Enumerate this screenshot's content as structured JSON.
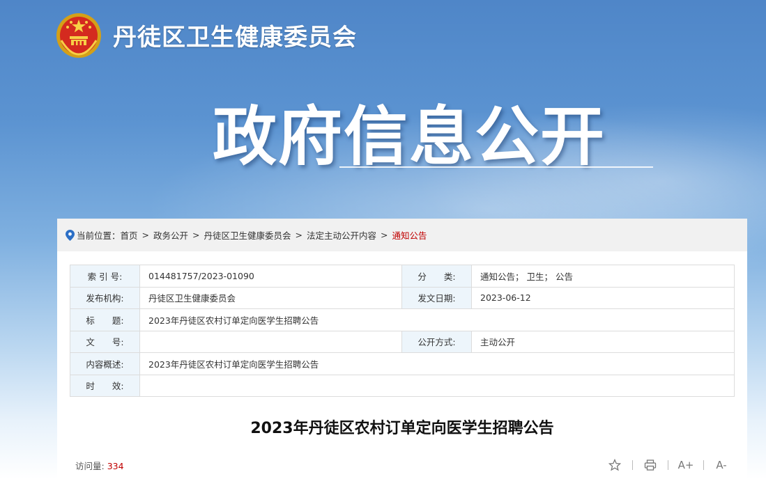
{
  "site": {
    "title": "丹徒区卫生健康委员会",
    "hero_title": "政府信息公开"
  },
  "breadcrumb": {
    "prefix": "当前位置：",
    "items": [
      "首页",
      "政务公开",
      "丹徒区卫生健康委员会",
      "法定主动公开内容"
    ],
    "separator": ">",
    "current": "通知公告"
  },
  "meta": {
    "index_label": "索 引 号:",
    "index_value": "014481757/2023-01090",
    "category_label": "分　　类:",
    "category_value": "通知公告；  卫生；  公告",
    "publisher_label": "发布机构:",
    "publisher_value": "丹徒区卫生健康委员会",
    "date_label": "发文日期:",
    "date_value": "2023-06-12",
    "title_label": "标　　题:",
    "title_value": "2023年丹徒区农村订单定向医学生招聘公告",
    "docno_label": "文　　号:",
    "docno_value": "",
    "mode_label": "公开方式:",
    "mode_value": "主动公开",
    "summary_label": "内容概述:",
    "summary_value": "2023年丹徒区农村订单定向医学生招聘公告",
    "validity_label": "时　　效:",
    "validity_value": ""
  },
  "article": {
    "title": "2023年丹徒区农村订单定向医学生招聘公告"
  },
  "footer": {
    "visits_label": "访问量:",
    "visits_value": "334",
    "font_increase": "A+",
    "font_decrease": "A-"
  },
  "colors": {
    "accent_red": "#c00000",
    "label_bg": "#edf5fb",
    "banner_blue": "#4f86c8"
  },
  "icons": [
    "national-emblem-icon",
    "location-pin-icon",
    "star-icon",
    "print-icon"
  ]
}
